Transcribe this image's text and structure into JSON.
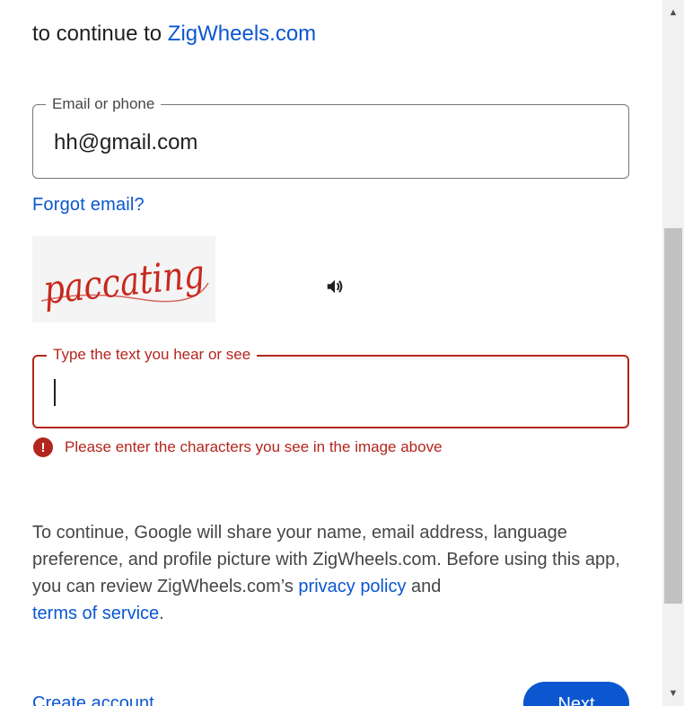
{
  "header": {
    "prefix": "to continue to",
    "app_name": "ZigWheels.com"
  },
  "email_field": {
    "label": "Email or phone",
    "value": "hh@gmail.com"
  },
  "forgot_email": "Forgot email?",
  "captcha": {
    "image_text": "paccating",
    "audio_icon": "speaker-icon"
  },
  "captcha_field": {
    "label": "Type the text you hear or see",
    "value": ""
  },
  "error": {
    "icon": "error-icon",
    "message": "Please enter the characters you see in the image above"
  },
  "consent": {
    "text_1": "To continue, Google will share your name, email address, language preference, and profile picture with ZigWheels.com. Before using this app, you can review ZigWheels.com’s ",
    "privacy_link": "privacy policy",
    "text_2": " and ",
    "terms_link": "terms of service",
    "text_3": "."
  },
  "footer": {
    "create_account": "Create account",
    "next": "Next"
  },
  "colors": {
    "accent": "#0b57d0",
    "error": "#b3261e",
    "captcha_ink": "#c8281e"
  }
}
